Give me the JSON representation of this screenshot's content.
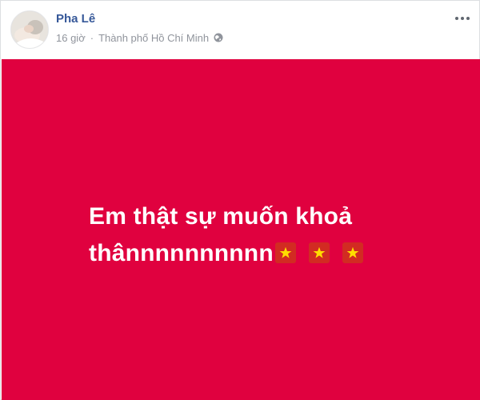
{
  "post": {
    "author": {
      "name": "Pha Lê",
      "avatar_icon": "avatar-photo"
    },
    "meta": {
      "time": "16 giờ",
      "separator": "·",
      "location": "Thành phố Hồ Chí Minh",
      "privacy_icon": "globe-icon"
    },
    "menu_icon": "more-options-icon",
    "status": {
      "background_color": "#e0013f",
      "text_color": "#ffffff",
      "line1": "Em thật sự muốn khoả",
      "line2": "thânnnnnnnnnn",
      "emojis": [
        {
          "icon": "vietnam-flag-icon"
        },
        {
          "icon": "vietnam-flag-icon"
        },
        {
          "icon": "vietnam-flag-icon"
        }
      ]
    }
  }
}
